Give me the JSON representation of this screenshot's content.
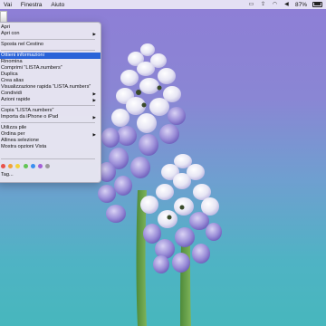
{
  "menubar": {
    "items": [
      "Vai",
      "Finestra",
      "Aiuto"
    ],
    "battery_percent": "87%"
  },
  "context_menu": {
    "items": [
      {
        "label": "Apri",
        "submenu": false
      },
      {
        "label": "Apri con",
        "submenu": true
      },
      {
        "label": "Sposta nel Cestino",
        "submenu": false
      },
      {
        "label": "Ottieni informazioni",
        "submenu": false,
        "highlighted": true
      },
      {
        "label": "Rinomina",
        "submenu": false
      },
      {
        "label": "Comprimi “LISTA.numbers”",
        "submenu": false
      },
      {
        "label": "Duplica",
        "submenu": false
      },
      {
        "label": "Crea alias",
        "submenu": false
      },
      {
        "label": "Visualizzazione rapida “LISTA.numbers”",
        "submenu": false
      },
      {
        "label": "Condividi",
        "submenu": true
      },
      {
        "label": "Azioni rapide",
        "submenu": true
      },
      {
        "label": "Copia “LISTA.numbers”",
        "submenu": false
      },
      {
        "label": "Importa da iPhone o iPad",
        "submenu": true
      },
      {
        "label": "Utilizza pile",
        "submenu": false
      },
      {
        "label": "Ordina per",
        "submenu": true
      },
      {
        "label": "Allinea selezione",
        "submenu": false
      },
      {
        "label": "Mostra opzioni Vista",
        "submenu": false
      },
      {
        "label": "Tag...",
        "submenu": false
      }
    ],
    "tag_colors": [
      "#e8524a",
      "#f0a33a",
      "#f3d23a",
      "#62c555",
      "#3a8ff0",
      "#a35fd6",
      "#9a9a9a"
    ]
  },
  "icons": {
    "menubar_right": [
      "display-icon",
      "upload-icon",
      "wifi-icon",
      "volume-icon",
      "battery-icon"
    ]
  }
}
